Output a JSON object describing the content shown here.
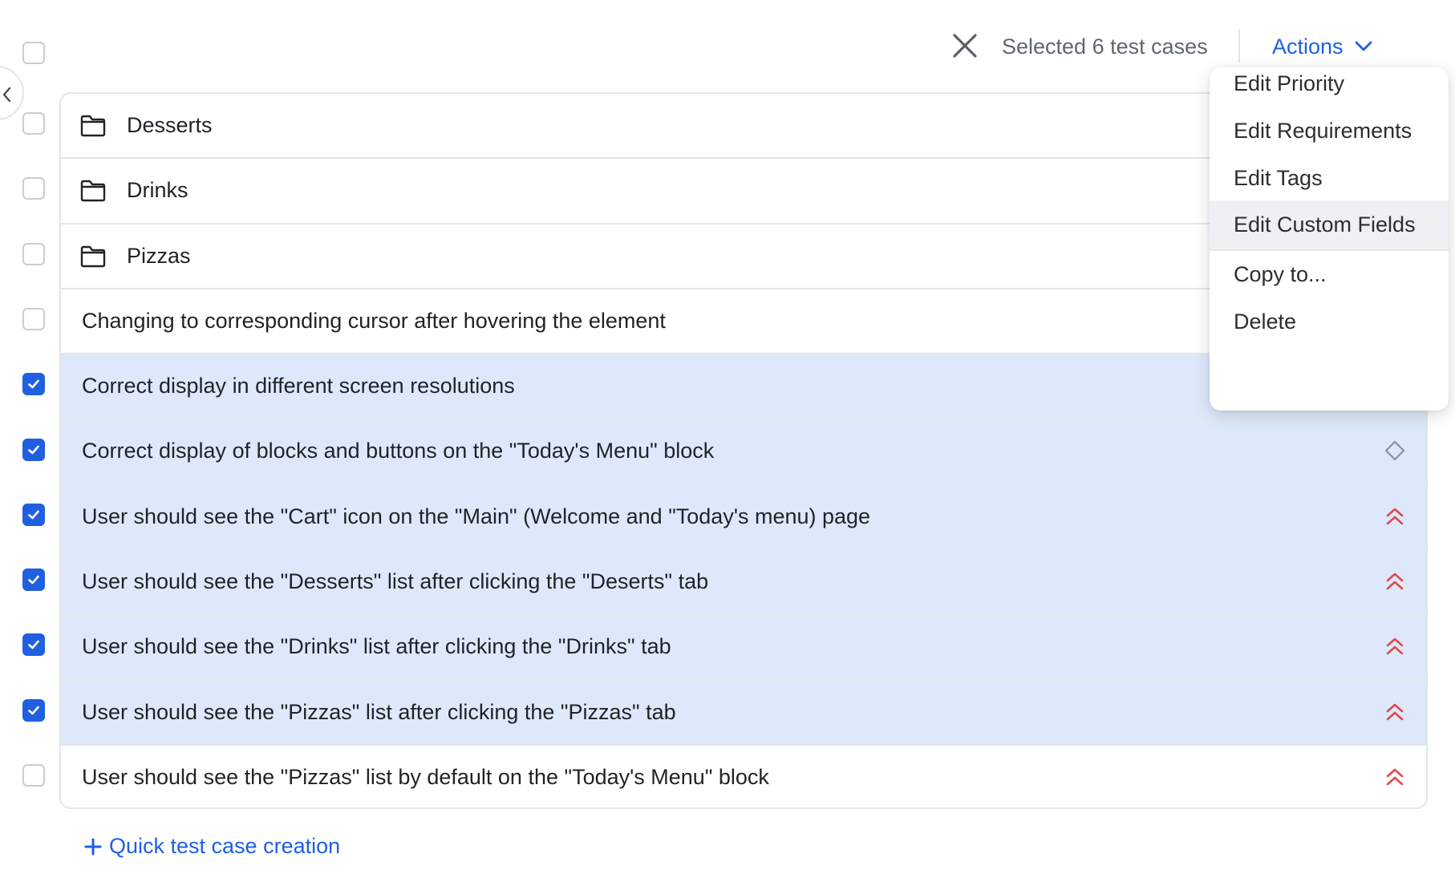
{
  "header": {
    "selected_text": "Selected 6 test cases",
    "actions_label": "Actions"
  },
  "colors": {
    "accent": "#1f5fe0",
    "selected_row": "#dde9fb",
    "priority_high": "#e5484d",
    "priority_none": "#8a9099"
  },
  "select_all_checked": false,
  "folders": [
    {
      "name": "Desserts",
      "checked": false
    },
    {
      "name": "Drinks",
      "checked": false
    },
    {
      "name": "Pizzas",
      "checked": false
    }
  ],
  "cases": [
    {
      "title": "Changing to corresponding cursor after hovering the element",
      "checked": false,
      "priority": ""
    },
    {
      "title": "Correct display in different screen resolutions",
      "checked": true,
      "priority": ""
    },
    {
      "title": "Correct display of blocks and buttons on the \"Today's Menu\" block",
      "checked": true,
      "priority": "none-diamond-icon"
    },
    {
      "title": "User should see the \"Cart\" icon on the \"Main\" (Welcome and \"Today's menu) page",
      "checked": true,
      "priority": "high-priority-icon"
    },
    {
      "title": "User should see the \"Desserts\" list after clicking the \"Deserts\" tab",
      "checked": true,
      "priority": "high-priority-icon"
    },
    {
      "title": "User should see the \"Drinks\" list after clicking the \"Drinks\" tab",
      "checked": true,
      "priority": "high-priority-icon"
    },
    {
      "title": "User should see the \"Pizzas\" list after clicking the \"Pizzas\" tab",
      "checked": true,
      "priority": "high-priority-icon"
    },
    {
      "title": "User should see the \"Pizzas\" list by default on the \"Today's Menu\" block",
      "checked": false,
      "priority": "high-priority-icon"
    }
  ],
  "quick_create_label": "Quick test case creation",
  "actions_menu": {
    "items": [
      {
        "label": "Edit Priority",
        "hovered": false
      },
      {
        "label": "Edit Requirements",
        "hovered": false
      },
      {
        "label": "Edit Tags",
        "hovered": false
      },
      {
        "label": "Edit Custom Fields",
        "hovered": true
      },
      {
        "label": "Copy to...",
        "hovered": false
      },
      {
        "label": "Delete",
        "hovered": false
      }
    ]
  }
}
